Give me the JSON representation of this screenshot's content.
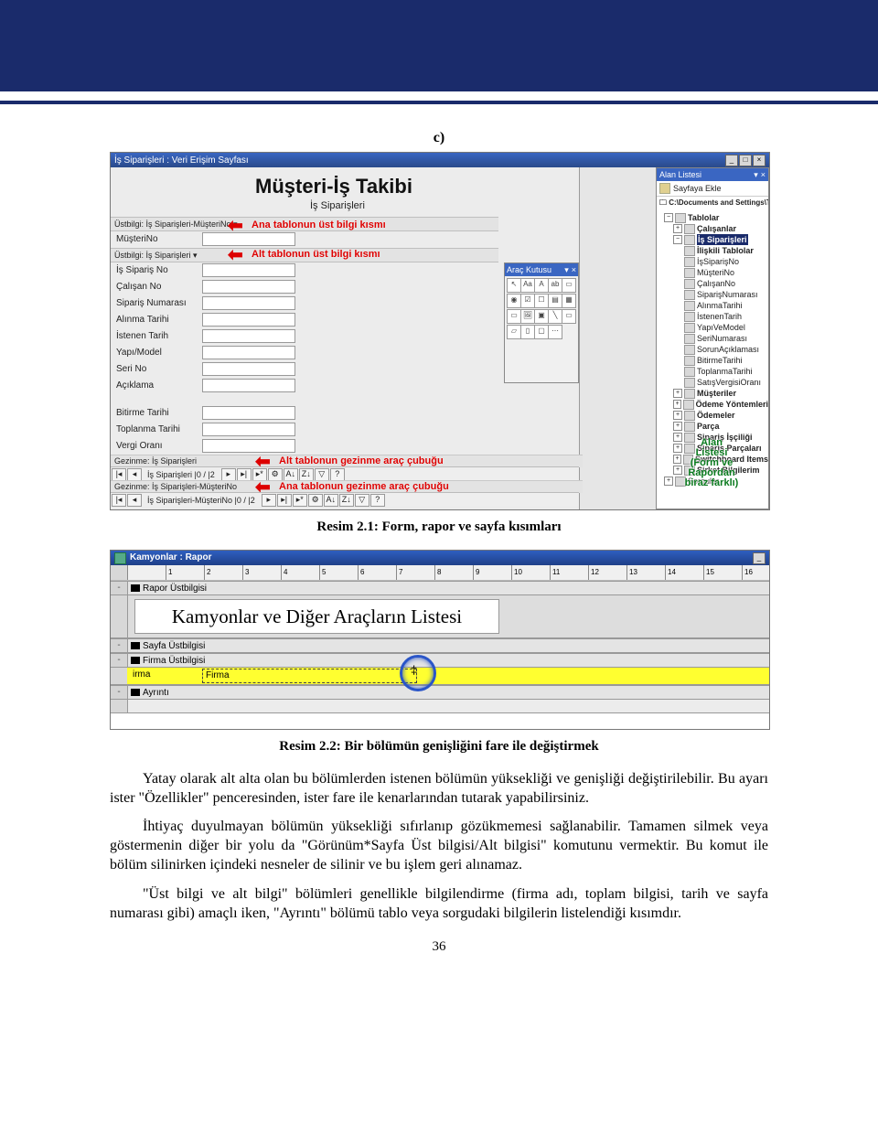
{
  "label_c": "c)",
  "figure1": {
    "window_title": "İş Siparişleri : Veri Erişim Sayfası",
    "big_title": "Müşteri-İş Takibi",
    "sub_title": "İş Siparişleri",
    "header1_label": "Üstbilgi: İş Siparişleri-MüşteriNo  ▾",
    "musterino_label": "MüşteriNo",
    "header2_label": "Üstbilgi: İş Siparişleri  ▾",
    "fields": [
      "İş Sipariş No",
      "Çalışan No",
      "Sipariş Numarası",
      "Alınma Tarihi",
      "İstenen Tarih",
      "Yapı/Model",
      "Seri No",
      "Açıklama"
    ],
    "fields2": [
      "Bitirme Tarihi",
      "Toplanma Tarihi",
      "Vergi Oranı"
    ],
    "nav1_label": "Gezinme: İş Siparişleri",
    "nav1_text": "İş Siparişleri  |0 /  |2",
    "nav2_label": "Gezinme: İş Siparişleri-MüşteriNo",
    "nav2_text": "İş Siparişleri-MüşteriNo  |0 /  |2",
    "toolbox_title": "Araç Kutusu",
    "fieldlist_title": "Alan Listesi",
    "add_page": "Sayfaya Ekle",
    "db_path": "C:\\Documents and Settings\\TU",
    "tablolar": "Tablolar",
    "tree": {
      "calisanlar": "Çalışanlar",
      "is_siparisleri": "İş Siparişleri",
      "items": [
        "İlişkili Tablolar",
        "İşSiparişNo",
        "MüşteriNo",
        "ÇalışanNo",
        "SiparişNumarası",
        "AlınmaTarihi",
        "İstenenTarih",
        "YapıVeModel",
        "SeriNumarası",
        "SorunAçıklaması",
        "BitirmeTarihi",
        "ToplanmaTarihi",
        "SatışVergisiOranı"
      ],
      "bottom": [
        "Müşteriler",
        "Ödeme Yöntemleri",
        "Ödemeler",
        "Parça",
        "Sipariş İşçiliği",
        "Sipariş Parçaları",
        "Switchboard Items",
        "Şirket Bilgilerim"
      ],
      "sorular": "Sorgular"
    },
    "annotations": {
      "a1": "Ana tablonun üst bilgi kısmı",
      "a2": "Alt tablonun üst bilgi kısmı",
      "a3": "Alt tablonun gezinme araç çubuğu",
      "a4": "Ana tablonun gezinme araç çubuğu",
      "a5": "Alan\nListesi\n(Form ve\nRapordan\nbiraz farklı)"
    }
  },
  "caption1": "Resim 2.1: Form, rapor ve sayfa kısımları",
  "figure2": {
    "title": "Kamyonlar : Rapor",
    "ruler_nums": [
      "1",
      "2",
      "3",
      "4",
      "5",
      "6",
      "7",
      "8",
      "9",
      "10",
      "11",
      "12",
      "13",
      "14",
      "15",
      "16"
    ],
    "sec1": "Rapor Üstbilgisi",
    "hdrtext": "Kamyonlar ve Diğer Araçların Listesi",
    "sec2": "Sayfa Üstbilgisi",
    "sec3": "Firma Üstbilgisi",
    "firma_lab": "irma",
    "firma_box": "Firma",
    "sec4": "Ayrıntı"
  },
  "caption2": "Resim 2.2: Bir bölümün genişliğini fare ile değiştirmek",
  "paragraphs": {
    "p1": "Yatay olarak alt alta olan bu bölümlerden istenen bölümün yüksekliği ve genişliği değiştirilebilir. Bu ayarı ister \"Özellikler\" penceresinden, ister fare ile kenarlarından tutarak yapabilirsiniz.",
    "p2": "İhtiyaç duyulmayan bölümün yüksekliği sıfırlanıp gözükmemesi sağlanabilir. Tamamen silmek veya göstermenin diğer bir yolu da \"Görünüm*Sayfa Üst bilgisi/Alt bilgisi\" komutunu vermektir. Bu komut ile bölüm silinirken içindeki nesneler de silinir ve bu işlem geri alınamaz.",
    "p3": "\"Üst bilgi ve alt bilgi\" bölümleri genellikle bilgilendirme (firma adı, toplam bilgisi, tarih ve sayfa numarası gibi) amaçlı iken, \"Ayrıntı\" bölümü tablo veya sorgudaki bilgilerin listelendiği kısımdır."
  },
  "page_number": "36"
}
